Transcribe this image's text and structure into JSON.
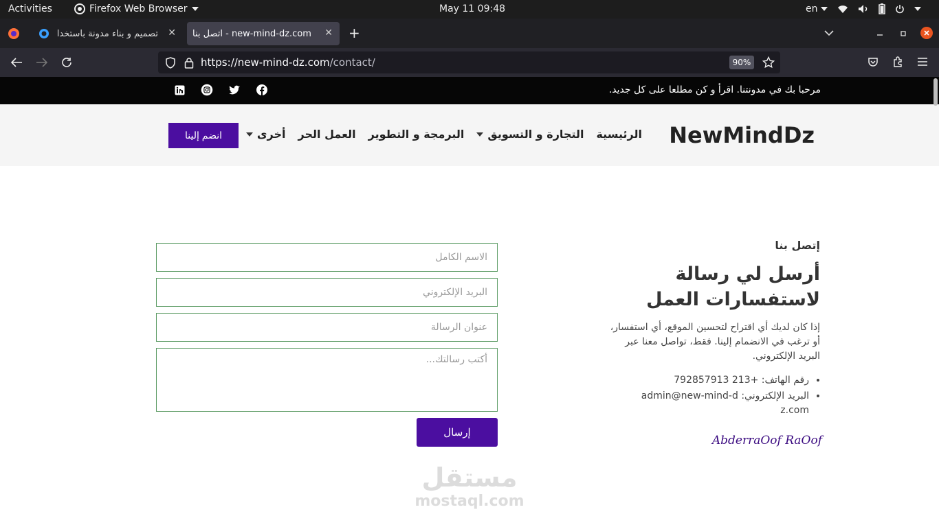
{
  "system_bar": {
    "activities": "Activities",
    "app_name": "Firefox Web Browser",
    "clock": "May 11  09:48",
    "lang": "en"
  },
  "tabs": [
    {
      "title": "تصميم و بناء مدونة باستخدا",
      "close": "✕"
    },
    {
      "title": "اتصل بنا - new-mind-dz.com",
      "close": "✕"
    }
  ],
  "new_tab": "+",
  "toolbar": {
    "url_host": "https://new-mind-dz.com",
    "url_path": "/contact/",
    "zoom": "90%"
  },
  "site": {
    "welcome": "مرحبا بك في مدونتنا. اقرأ و كن مطلعا على كل جديد.",
    "logo": "NewMindDz",
    "menu": [
      "الرئيسية",
      "التجارة و التسويق",
      "البرمجة و التطوير",
      "العمل الحر",
      "أخرى"
    ],
    "join_button": "انضم إلينا"
  },
  "contact": {
    "kicker": "إتصل بنا",
    "heading_line1": "أرسل لي رسالة",
    "heading_line2": "لاستفسارات العمل",
    "description": "إذا كان لديك أي اقتراح لتحسين الموقع، أي استفسار، أو ترغب في الانضمام إلينا. فقط، تواصل معنا عبر البريد الإلكتروني.",
    "phone": "رقم الهاتف: +213 792857913",
    "email": "البريد الإلكتروني: admin@new-mind-dz.com",
    "signature": "AbderraOof RaOof"
  },
  "form": {
    "name_placeholder": "الاسم الكامل",
    "email_placeholder": "البريد الإلكتروني",
    "subject_placeholder": "عنوان الرسالة",
    "message_placeholder": "أكتب رسالتك...",
    "submit": "إرسال"
  },
  "watermark": {
    "arabic": "مستقل",
    "latin": "mostaql.com"
  },
  "icons": [
    "firefox-icon",
    "wifi-icon",
    "volume-icon",
    "battery-icon",
    "power-icon",
    "linkedin-icon",
    "instagram-icon",
    "twitter-icon",
    "facebook-icon"
  ]
}
